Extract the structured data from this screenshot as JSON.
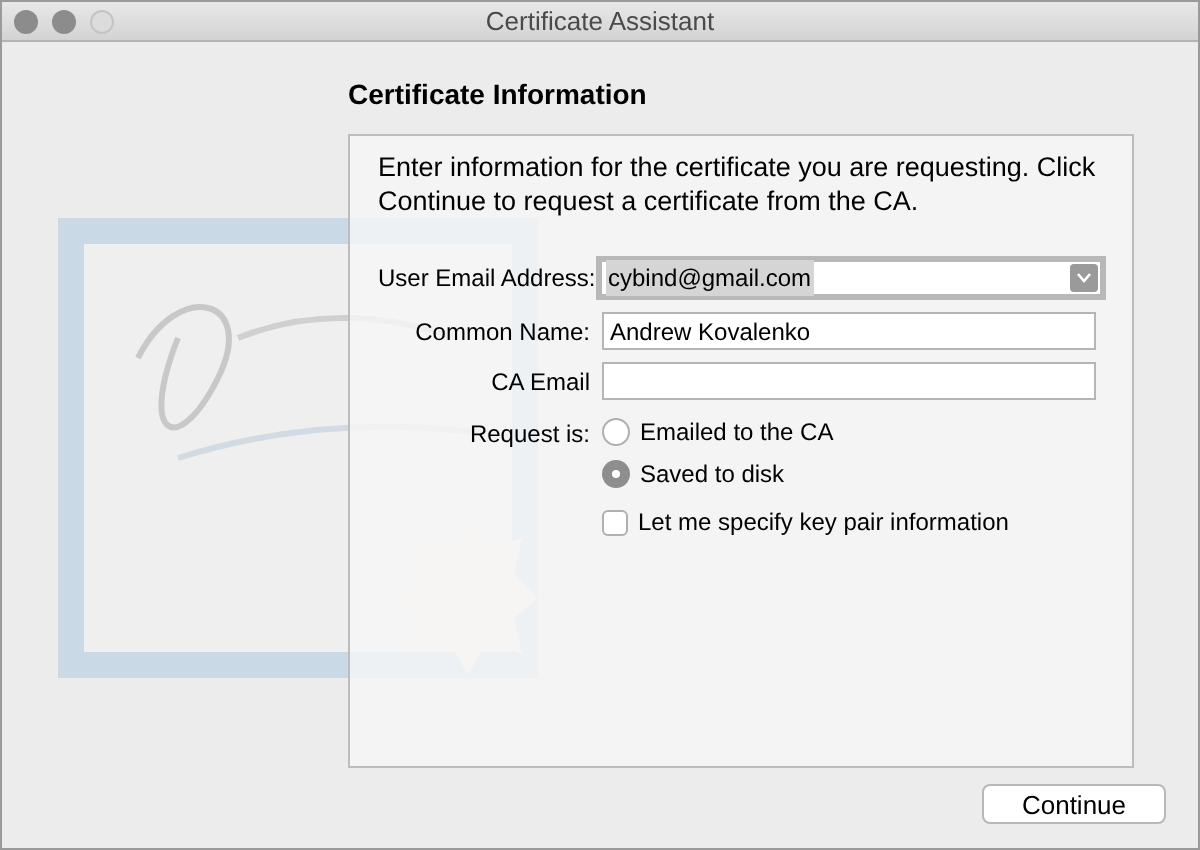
{
  "window": {
    "title": "Certificate Assistant"
  },
  "heading": "Certificate Information",
  "intro": "Enter information for the certificate you are requesting. Click Continue to request a certificate from the CA.",
  "fields": [
    {
      "label": "User Email Address:",
      "kind": "dropdown",
      "value": "cybind@gmail.com"
    },
    {
      "label": "Common Name:",
      "kind": "text",
      "value": "Andrew Kovalenko"
    },
    {
      "label": "CA Email",
      "kind": "text"
    }
  ],
  "request": {
    "label": "Request is:",
    "options": [
      {
        "label": "Emailed to the CA",
        "selected": false
      },
      {
        "label": "Saved to disk",
        "selected": true
      }
    ]
  },
  "key_pair": {
    "label": "Let me specify key pair information",
    "checked": false
  },
  "buttons": [
    {
      "label": "Continue"
    }
  ]
}
